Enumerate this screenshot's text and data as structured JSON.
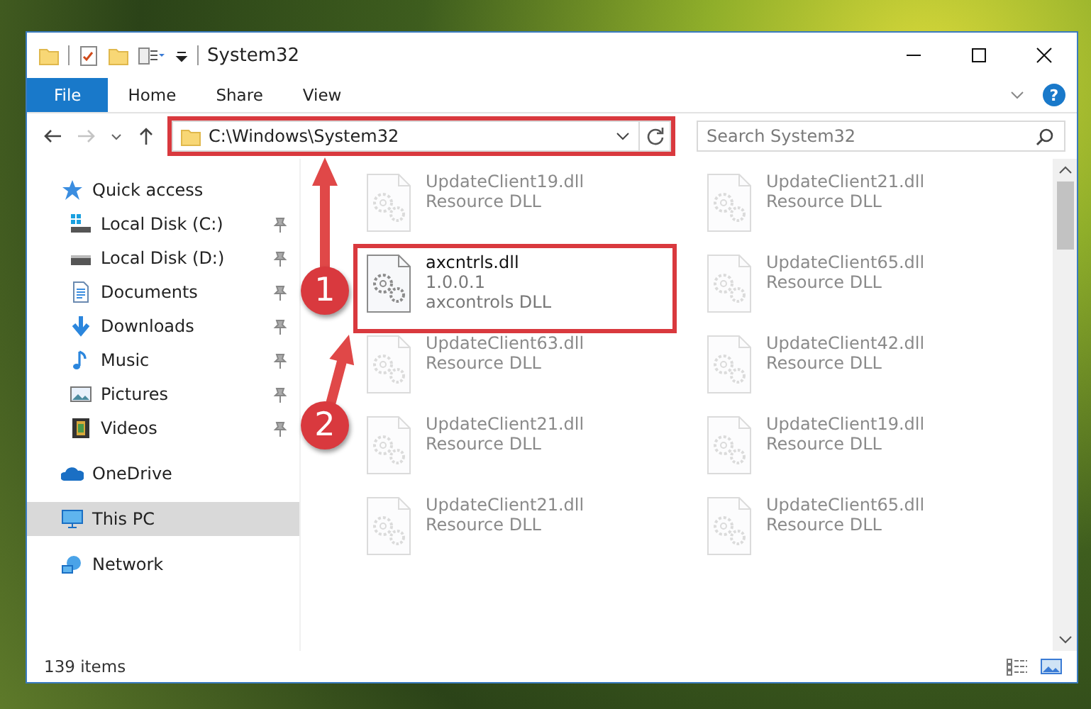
{
  "window": {
    "title": "System32"
  },
  "ribbon": {
    "tabs": [
      {
        "label": "File",
        "kind": "file",
        "selected": false
      },
      {
        "label": "Home",
        "kind": "tab",
        "selected": false
      },
      {
        "label": "Share",
        "kind": "tab",
        "selected": false
      },
      {
        "label": "View",
        "kind": "tab",
        "selected": false
      }
    ],
    "help": "?"
  },
  "address_bar": {
    "path": "C:\\Windows\\System32",
    "forward_disabled": true
  },
  "search": {
    "placeholder": "Search System32"
  },
  "sidebar": {
    "items": [
      {
        "label": "Quick access",
        "selected": false,
        "children": [
          {
            "label": "Local Disk (C:)",
            "pinned": true,
            "selected": false
          },
          {
            "label": "Local Disk (D:)",
            "pinned": true,
            "selected": false
          },
          {
            "label": "Documents",
            "pinned": true,
            "selected": false
          },
          {
            "label": "Downloads",
            "pinned": true,
            "selected": false
          },
          {
            "label": "Music",
            "pinned": true,
            "selected": false
          },
          {
            "label": "Pictures",
            "pinned": true,
            "selected": false
          },
          {
            "label": "Videos",
            "pinned": true,
            "selected": false
          }
        ]
      },
      {
        "label": "OneDrive",
        "selected": false
      },
      {
        "label": "This PC",
        "selected": true
      },
      {
        "label": "Network",
        "selected": false
      }
    ]
  },
  "files": [
    {
      "name": "UpdateClient19.dll",
      "lines": [
        "Resource DLL"
      ],
      "blurred": true
    },
    {
      "name": "UpdateClient21.dll",
      "lines": [
        "Resource DLL"
      ],
      "blurred": true
    },
    {
      "name": "axcntrls.dll",
      "lines": [
        "1.0.0.1",
        "axcontrols DLL"
      ],
      "blurred": false
    },
    {
      "name": "UpdateClient65.dll",
      "lines": [
        "Resource DLL"
      ],
      "blurred": true
    },
    {
      "name": "UpdateClient63.dll",
      "lines": [
        "Resource DLL"
      ],
      "blurred": true
    },
    {
      "name": "UpdateClient42.dll",
      "lines": [
        "Resource DLL"
      ],
      "blurred": true
    },
    {
      "name": "UpdateClient21.dll",
      "lines": [
        "Resource DLL"
      ],
      "blurred": true
    },
    {
      "name": "UpdateClient19.dll",
      "lines": [
        "Resource DLL"
      ],
      "blurred": true
    },
    {
      "name": "UpdateClient21.dll",
      "lines": [
        "Resource DLL"
      ],
      "blurred": true
    },
    {
      "name": "UpdateClient65.dll",
      "lines": [
        "Resource DLL"
      ],
      "blurred": true
    }
  ],
  "status_bar": {
    "item_count": "139 items"
  },
  "annotations": [
    {
      "number": "1"
    },
    {
      "number": "2"
    }
  ]
}
